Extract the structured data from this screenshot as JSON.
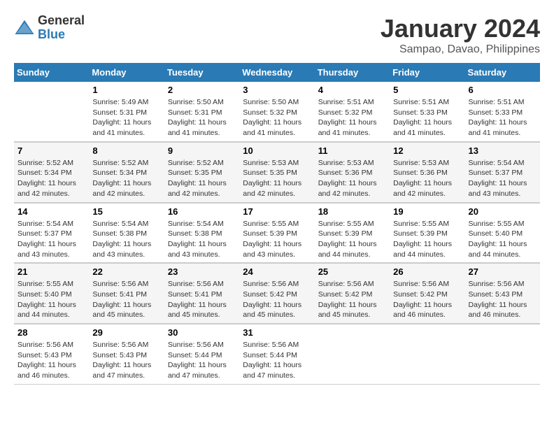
{
  "header": {
    "logo_general": "General",
    "logo_blue": "Blue",
    "month": "January 2024",
    "location": "Sampao, Davao, Philippines"
  },
  "days_of_week": [
    "Sunday",
    "Monday",
    "Tuesday",
    "Wednesday",
    "Thursday",
    "Friday",
    "Saturday"
  ],
  "weeks": [
    [
      {
        "day": "",
        "info": ""
      },
      {
        "day": "1",
        "info": "Sunrise: 5:49 AM\nSunset: 5:31 PM\nDaylight: 11 hours\nand 41 minutes."
      },
      {
        "day": "2",
        "info": "Sunrise: 5:50 AM\nSunset: 5:31 PM\nDaylight: 11 hours\nand 41 minutes."
      },
      {
        "day": "3",
        "info": "Sunrise: 5:50 AM\nSunset: 5:32 PM\nDaylight: 11 hours\nand 41 minutes."
      },
      {
        "day": "4",
        "info": "Sunrise: 5:51 AM\nSunset: 5:32 PM\nDaylight: 11 hours\nand 41 minutes."
      },
      {
        "day": "5",
        "info": "Sunrise: 5:51 AM\nSunset: 5:33 PM\nDaylight: 11 hours\nand 41 minutes."
      },
      {
        "day": "6",
        "info": "Sunrise: 5:51 AM\nSunset: 5:33 PM\nDaylight: 11 hours\nand 41 minutes."
      }
    ],
    [
      {
        "day": "7",
        "info": "Sunrise: 5:52 AM\nSunset: 5:34 PM\nDaylight: 11 hours\nand 42 minutes."
      },
      {
        "day": "8",
        "info": "Sunrise: 5:52 AM\nSunset: 5:34 PM\nDaylight: 11 hours\nand 42 minutes."
      },
      {
        "day": "9",
        "info": "Sunrise: 5:52 AM\nSunset: 5:35 PM\nDaylight: 11 hours\nand 42 minutes."
      },
      {
        "day": "10",
        "info": "Sunrise: 5:53 AM\nSunset: 5:35 PM\nDaylight: 11 hours\nand 42 minutes."
      },
      {
        "day": "11",
        "info": "Sunrise: 5:53 AM\nSunset: 5:36 PM\nDaylight: 11 hours\nand 42 minutes."
      },
      {
        "day": "12",
        "info": "Sunrise: 5:53 AM\nSunset: 5:36 PM\nDaylight: 11 hours\nand 42 minutes."
      },
      {
        "day": "13",
        "info": "Sunrise: 5:54 AM\nSunset: 5:37 PM\nDaylight: 11 hours\nand 43 minutes."
      }
    ],
    [
      {
        "day": "14",
        "info": "Sunrise: 5:54 AM\nSunset: 5:37 PM\nDaylight: 11 hours\nand 43 minutes."
      },
      {
        "day": "15",
        "info": "Sunrise: 5:54 AM\nSunset: 5:38 PM\nDaylight: 11 hours\nand 43 minutes."
      },
      {
        "day": "16",
        "info": "Sunrise: 5:54 AM\nSunset: 5:38 PM\nDaylight: 11 hours\nand 43 minutes."
      },
      {
        "day": "17",
        "info": "Sunrise: 5:55 AM\nSunset: 5:39 PM\nDaylight: 11 hours\nand 43 minutes."
      },
      {
        "day": "18",
        "info": "Sunrise: 5:55 AM\nSunset: 5:39 PM\nDaylight: 11 hours\nand 44 minutes."
      },
      {
        "day": "19",
        "info": "Sunrise: 5:55 AM\nSunset: 5:39 PM\nDaylight: 11 hours\nand 44 minutes."
      },
      {
        "day": "20",
        "info": "Sunrise: 5:55 AM\nSunset: 5:40 PM\nDaylight: 11 hours\nand 44 minutes."
      }
    ],
    [
      {
        "day": "21",
        "info": "Sunrise: 5:55 AM\nSunset: 5:40 PM\nDaylight: 11 hours\nand 44 minutes."
      },
      {
        "day": "22",
        "info": "Sunrise: 5:56 AM\nSunset: 5:41 PM\nDaylight: 11 hours\nand 45 minutes."
      },
      {
        "day": "23",
        "info": "Sunrise: 5:56 AM\nSunset: 5:41 PM\nDaylight: 11 hours\nand 45 minutes."
      },
      {
        "day": "24",
        "info": "Sunrise: 5:56 AM\nSunset: 5:42 PM\nDaylight: 11 hours\nand 45 minutes."
      },
      {
        "day": "25",
        "info": "Sunrise: 5:56 AM\nSunset: 5:42 PM\nDaylight: 11 hours\nand 45 minutes."
      },
      {
        "day": "26",
        "info": "Sunrise: 5:56 AM\nSunset: 5:42 PM\nDaylight: 11 hours\nand 46 minutes."
      },
      {
        "day": "27",
        "info": "Sunrise: 5:56 AM\nSunset: 5:43 PM\nDaylight: 11 hours\nand 46 minutes."
      }
    ],
    [
      {
        "day": "28",
        "info": "Sunrise: 5:56 AM\nSunset: 5:43 PM\nDaylight: 11 hours\nand 46 minutes."
      },
      {
        "day": "29",
        "info": "Sunrise: 5:56 AM\nSunset: 5:43 PM\nDaylight: 11 hours\nand 47 minutes."
      },
      {
        "day": "30",
        "info": "Sunrise: 5:56 AM\nSunset: 5:44 PM\nDaylight: 11 hours\nand 47 minutes."
      },
      {
        "day": "31",
        "info": "Sunrise: 5:56 AM\nSunset: 5:44 PM\nDaylight: 11 hours\nand 47 minutes."
      },
      {
        "day": "",
        "info": ""
      },
      {
        "day": "",
        "info": ""
      },
      {
        "day": "",
        "info": ""
      }
    ]
  ]
}
